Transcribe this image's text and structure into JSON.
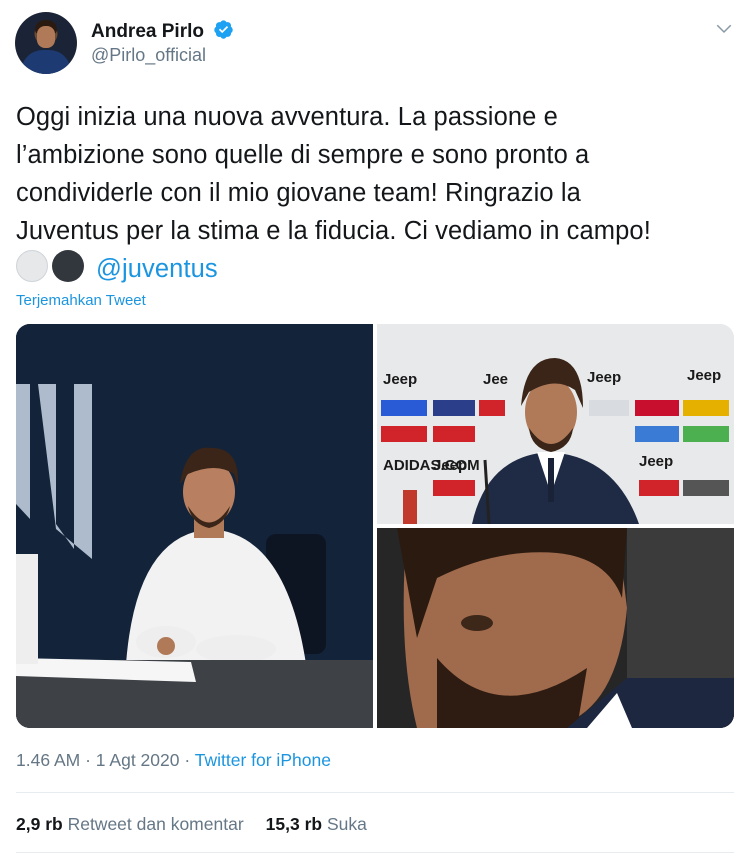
{
  "author": {
    "display_name": "Andrea Pirlo",
    "handle": "@Pirlo_official",
    "verified": true
  },
  "tweet": {
    "lines": [
      "Oggi inizia una nuova avventura. La passione e",
      "l’ambizione sono quelle di sempre e sono pronto a",
      "condividerle con il mio giovane team! Ringrazio la",
      "Juventus per la stima e la fiducia. Ci vediamo in campo!"
    ],
    "emojis": [
      "white-circle",
      "black-circle"
    ],
    "mention": "@juventus",
    "translate_label": "Terjemahkan Tweet"
  },
  "media": {
    "photo_left_alt": "Pirlo signing contract",
    "photo_tr_alt": "Pirlo at press conference",
    "photo_br_alt": "Pirlo close-up"
  },
  "meta": {
    "time": "1.46 AM",
    "date": "1 Agt 2020",
    "separator": "·",
    "source": "Twitter for iPhone"
  },
  "stats": {
    "retweets_count": "2,9 rb",
    "retweets_label": "Retweet dan komentar",
    "likes_count": "15,3 rb",
    "likes_label": "Suka"
  },
  "colors": {
    "link": "#1b95e0",
    "secondary": "#657786",
    "text": "#14171a"
  }
}
